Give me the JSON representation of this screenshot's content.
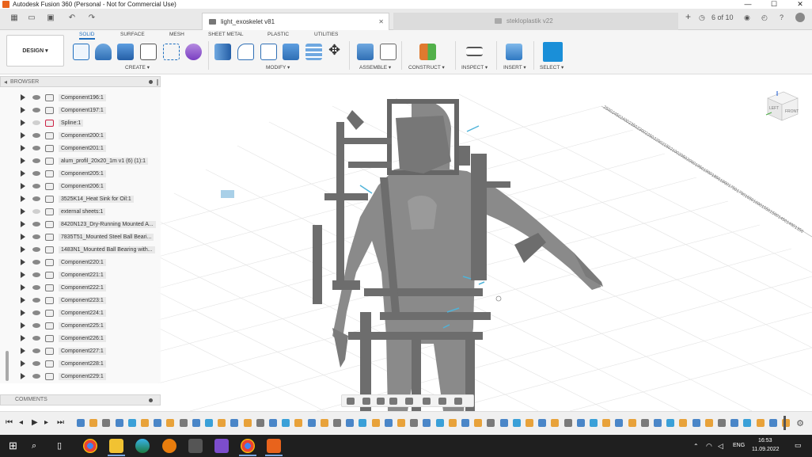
{
  "app": {
    "title": "Autodesk Fusion 360 (Personal - Not for Commercial Use)",
    "window_controls": {
      "minimize": "—",
      "maximize": "☐",
      "close": "✕"
    }
  },
  "tabs": [
    {
      "label": "light_exoskelet v81",
      "active": true
    },
    {
      "label": "stekloplastik v22",
      "active": false
    }
  ],
  "tabstrip_right": {
    "count_label": "6 of 10"
  },
  "toolbar": {
    "design_label": "DESIGN ▾",
    "workspace_tabs": [
      "SOLID",
      "SURFACE",
      "MESH",
      "SHEET METAL",
      "PLASTIC",
      "UTILITIES"
    ],
    "groups": [
      "CREATE ▾",
      "MODIFY ▾",
      "ASSEMBLE ▾",
      "CONSTRUCT ▾",
      "INSPECT ▾",
      "INSERT ▾",
      "SELECT ▾"
    ]
  },
  "browser": {
    "header": "BROWSER",
    "items": [
      {
        "label": "Component196:1",
        "icon": "component-icon",
        "visible": true
      },
      {
        "label": "Component197:1",
        "icon": "component-icon",
        "visible": true
      },
      {
        "label": "Spline:1",
        "icon": "spline-icon",
        "visible": false
      },
      {
        "label": "Component200:1",
        "icon": "component-icon",
        "visible": true
      },
      {
        "label": "Component201:1",
        "icon": "component-icon",
        "visible": true
      },
      {
        "label": "alum_profil_20x20_1m v1 (6) (1):1",
        "icon": "component-icon",
        "visible": true
      },
      {
        "label": "Component205:1",
        "icon": "component-icon",
        "visible": true
      },
      {
        "label": "Component206:1",
        "icon": "component-icon",
        "visible": true
      },
      {
        "label": "3525K14_Heat Sink for Oil:1",
        "icon": "component-icon",
        "visible": true
      },
      {
        "label": "external sheets:1",
        "icon": "component-icon",
        "visible": false
      },
      {
        "label": "8420N123_Dry-Running Mounted A...",
        "icon": "component-icon",
        "visible": true
      },
      {
        "label": "7835T51_Mounted Steel Ball Beari...",
        "icon": "component-icon",
        "visible": true
      },
      {
        "label": "1483N1_Mounted Ball Bearing with...",
        "icon": "component-icon",
        "visible": true
      },
      {
        "label": "Component220:1",
        "icon": "component-icon",
        "visible": true
      },
      {
        "label": "Component221:1",
        "icon": "component-icon",
        "visible": true
      },
      {
        "label": "Component222:1",
        "icon": "component-icon",
        "visible": true
      },
      {
        "label": "Component223:1",
        "icon": "component-icon",
        "visible": true
      },
      {
        "label": "Component224:1",
        "icon": "component-icon",
        "visible": true
      },
      {
        "label": "Component225:1",
        "icon": "component-icon",
        "visible": true
      },
      {
        "label": "Component226:1",
        "icon": "component-icon",
        "visible": true
      },
      {
        "label": "Component227:1",
        "icon": "component-icon",
        "visible": true
      },
      {
        "label": "Component228:1",
        "icon": "component-icon",
        "visible": true
      },
      {
        "label": "Component229:1",
        "icon": "component-icon",
        "visible": true
      }
    ]
  },
  "comments": {
    "label": "COMMENTS"
  },
  "viewcube": {
    "top": "TOP",
    "front": "FRONT",
    "left": "LEFT"
  },
  "ruler": {
    "back_axis": [
      "2500",
      "2450",
      "2400",
      "2350",
      "2300",
      "2250",
      "2200",
      "2150",
      "2100",
      "2050",
      "2000",
      "1950",
      "1900",
      "1850",
      "1800",
      "1750",
      "1700",
      "1650",
      "1600",
      "1550",
      "1500",
      "1450",
      "1400",
      "1350"
    ]
  },
  "taskbar": {
    "language": "ENG",
    "time": "16:53",
    "date": "11.09.2022"
  },
  "colors": {
    "accent": "#1f6fbf",
    "app_orange": "#e8631c",
    "taskbar": "#1f1f1f"
  }
}
